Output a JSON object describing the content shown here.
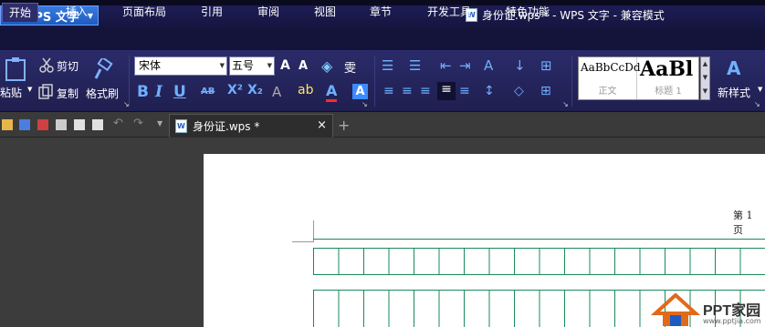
{
  "app": {
    "name": "WPS 文字"
  },
  "window": {
    "title": "身份证.wps * - WPS 文字 - 兼容模式"
  },
  "menu": {
    "tabs": [
      {
        "label": "开始",
        "active": true
      },
      {
        "label": "插入"
      },
      {
        "label": "页面布局"
      },
      {
        "label": "引用"
      },
      {
        "label": "审阅"
      },
      {
        "label": "视图"
      },
      {
        "label": "章节"
      },
      {
        "label": "开发工具"
      },
      {
        "label": "特色功能"
      }
    ]
  },
  "ribbon": {
    "paste_label": "粘贴",
    "cut_label": "剪切",
    "copy_label": "复制",
    "format_painter_label": "格式刷",
    "font_name": "宋体",
    "font_size": "五号",
    "styles": [
      {
        "sample": "AaBbCcDd",
        "label": "正文"
      },
      {
        "sample": "AaBl",
        "label": "标题 1"
      }
    ],
    "new_style_label": "新样式"
  },
  "document_tab": {
    "label": "身份证.wps *",
    "close": "×",
    "new": "+"
  },
  "page": {
    "page_number_text": "第 1 页"
  },
  "watermark": {
    "brand": "PPT家园",
    "url": "www.pptjia.com"
  },
  "colors": {
    "ribbon": "#1f1f50",
    "accent": "#1e5bc0",
    "grid": "#1a8a5a"
  }
}
